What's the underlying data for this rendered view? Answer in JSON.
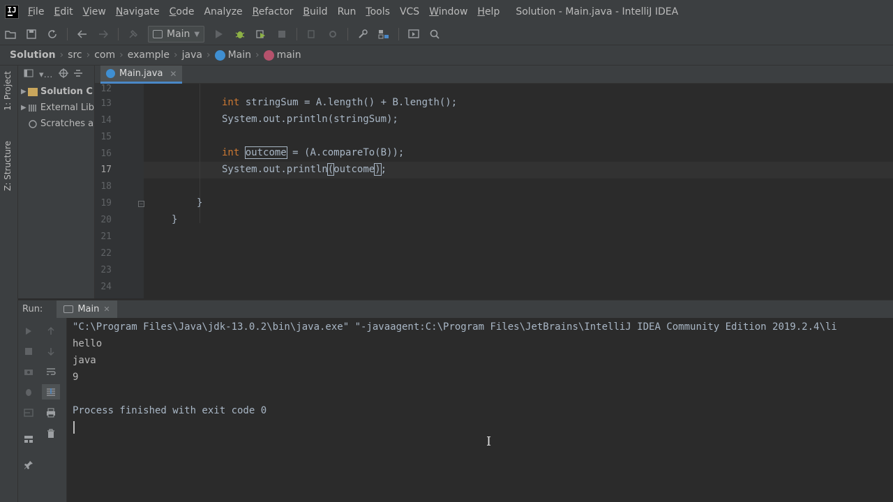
{
  "app": {
    "logo": "IJ",
    "window_title": "Solution - Main.java - IntelliJ IDEA"
  },
  "menu": [
    {
      "mn": "F",
      "rest": "ile"
    },
    {
      "mn": "E",
      "rest": "dit"
    },
    {
      "mn": "V",
      "rest": "iew"
    },
    {
      "mn": "N",
      "rest": "avigate"
    },
    {
      "mn": "C",
      "rest": "ode"
    },
    {
      "mn": "",
      "rest": "Analyze"
    },
    {
      "mn": "R",
      "rest": "efactor"
    },
    {
      "mn": "B",
      "rest": "uild"
    },
    {
      "mn": "",
      "rest": "Run"
    },
    {
      "mn": "T",
      "rest": "ools"
    },
    {
      "mn": "",
      "rest": "VCS"
    },
    {
      "mn": "W",
      "rest": "indow"
    },
    {
      "mn": "H",
      "rest": "elp"
    }
  ],
  "toolbar": {
    "run_config": "Main"
  },
  "breadcrumb": [
    "Solution",
    "src",
    "com",
    "example",
    "java",
    "Main",
    "main"
  ],
  "left_stripe": {
    "project_tab": "1: Project",
    "structure_tab": "Z: Structure"
  },
  "project_panel": {
    "items": [
      {
        "label": "Solution C",
        "bold": true
      },
      {
        "label": "External Lib"
      },
      {
        "label": "Scratches a"
      }
    ]
  },
  "editor": {
    "tab": "Main.java",
    "line_numbers": [
      "12",
      "13",
      "14",
      "15",
      "16",
      "17",
      "18",
      "19",
      "20",
      "21",
      "22",
      "23",
      "24"
    ],
    "current_line": 17,
    "code": {
      "l13_kw": "int",
      "l13_rest": " stringSum = A.length() + B.length();",
      "l14": "System.out.println(stringSum);",
      "l16_kw": "int",
      "l16_var": "outcome",
      "l16_rest": " = (A.compareTo(B));",
      "l17_pre": "System.",
      "l17_out": "out",
      "l17_mid": ".println",
      "l17_open": "(",
      "l17_var": "outcome",
      "l17_close": ")",
      "l17_end": ";",
      "l19": "}",
      "l20": "}"
    }
  },
  "run_panel": {
    "label": "Run:",
    "tab": "Main",
    "console": [
      "\"C:\\Program Files\\Java\\jdk-13.0.2\\bin\\java.exe\" \"-javaagent:C:\\Program Files\\JetBrains\\IntelliJ IDEA Community Edition 2019.2.4\\li",
      "hello",
      "java",
      "9",
      "",
      "Process finished with exit code 0"
    ]
  },
  "colors": {
    "background": "#2b2b2b",
    "panel": "#3c3f41",
    "keyword": "#cc7832",
    "text": "#a9b7c6",
    "field": "#9876aa",
    "accent": "#4a88c7"
  }
}
